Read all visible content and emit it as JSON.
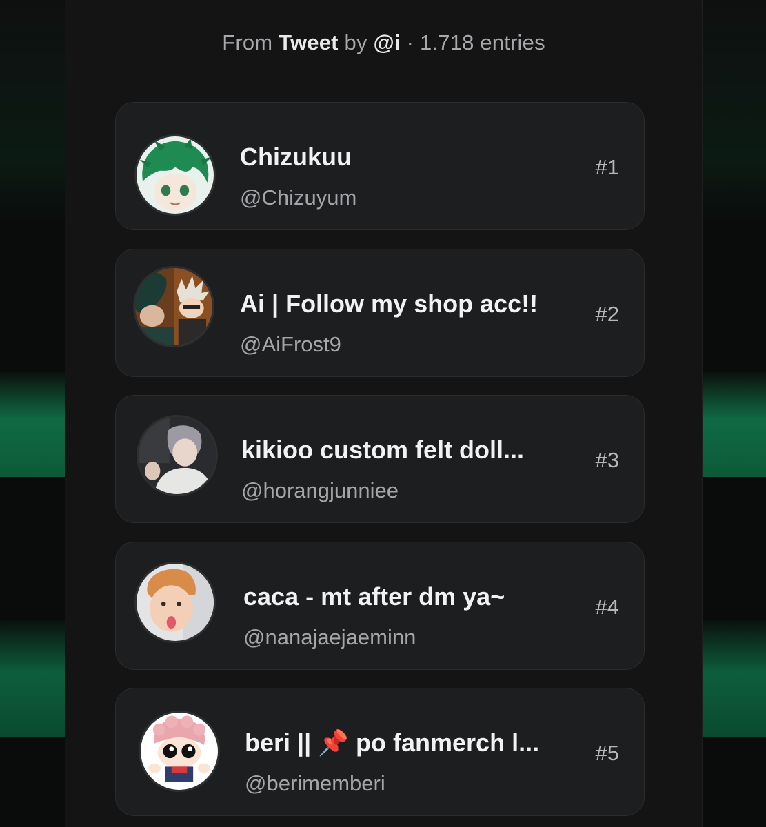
{
  "header": {
    "from_label": "From",
    "source_label": "Tweet",
    "by_label": "by",
    "author": "@i",
    "entries_label": "· 1.718 entries"
  },
  "entries": [
    {
      "name": "Chizukuu",
      "handle": "@Chizuyum",
      "rank": "#1",
      "avatar_icon": "anime-green-hair-avatar-icon"
    },
    {
      "name": "Ai | Follow my shop acc!!",
      "handle": "@AiFrost9",
      "rank": "#2",
      "avatar_icon": "anime-duo-avatar-icon"
    },
    {
      "name": "kikioo custom felt doll...",
      "handle": "@horangjunniee",
      "rank": "#3",
      "avatar_icon": "person-photo-avatar-icon"
    },
    {
      "name": "caca - mt after dm ya~",
      "handle": "@nanajaejaeminn",
      "rank": "#4",
      "avatar_icon": "person-selfie-avatar-icon"
    },
    {
      "name_prefix": "beri ||",
      "name_suffix": "po fanmerch l...",
      "pin_icon": "📌",
      "handle": "@berimemberi",
      "rank": "#5",
      "avatar_icon": "chibi-pink-hair-avatar-icon"
    }
  ],
  "colors": {
    "panel": "#141415",
    "card": "#1d1e20",
    "accent_glow": "#0f6a42"
  }
}
